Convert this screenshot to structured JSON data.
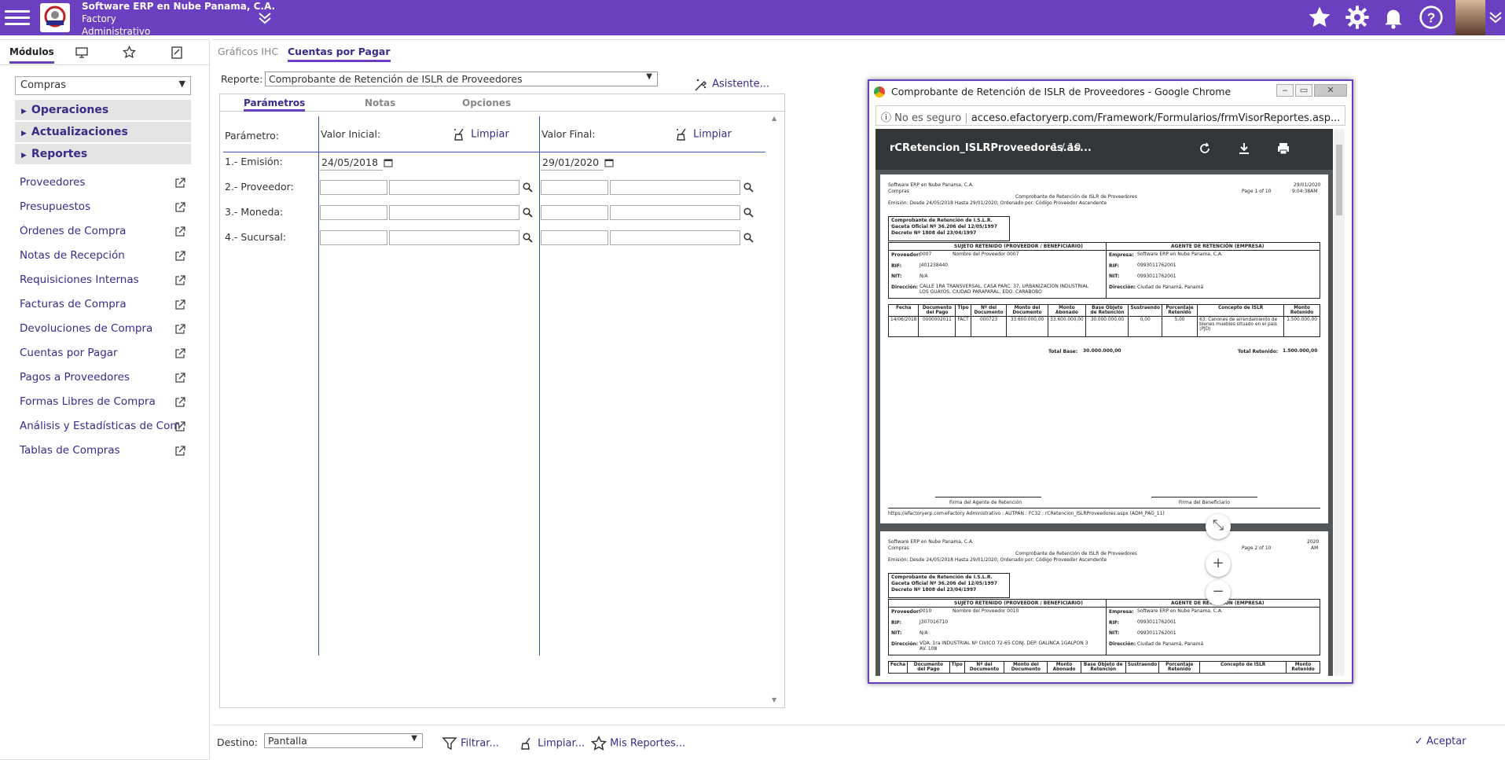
{
  "topbar": {
    "company_line1": "Software ERP en Nube Panama, C.A.",
    "company_line2": "Factory",
    "company_line3": "Administrativo",
    "icons": [
      "menu-icon",
      "star-icon",
      "gear-icon",
      "bell-icon",
      "help-icon",
      "user-avatar",
      "chevron-down-icon"
    ],
    "accent": "#6a3fc0"
  },
  "sidebar": {
    "tabs": [
      {
        "label": "Módulos"
      },
      {
        "icon": "monitor-icon"
      },
      {
        "icon": "star-icon"
      },
      {
        "icon": "report-icon"
      }
    ],
    "module_selected": "Compras",
    "sections": [
      {
        "label": "Operaciones"
      },
      {
        "label": "Actualizaciones"
      },
      {
        "label": "Reportes"
      }
    ],
    "items": [
      {
        "label": "Proveedores"
      },
      {
        "label": "Presupuestos"
      },
      {
        "label": "Órdenes de Compra"
      },
      {
        "label": "Notas de Recepción"
      },
      {
        "label": "Requisiciones Internas"
      },
      {
        "label": "Facturas de Compra"
      },
      {
        "label": "Devoluciones de Compra"
      },
      {
        "label": "Cuentas por Pagar"
      },
      {
        "label": "Pagos a Proveedores"
      },
      {
        "label": "Formas Libres de Compra"
      },
      {
        "label": "Análisis y Estadísticas de Com"
      },
      {
        "label": "Tablas de Compras"
      }
    ]
  },
  "main": {
    "tabs": [
      {
        "label": "Gráficos IHC"
      },
      {
        "label": "Cuentas por Pagar"
      }
    ],
    "reporte_label": "Reporte:",
    "reporte_value": "Comprobante de Retención de ISLR de Proveedores",
    "asistente": "Asistente...",
    "param_tabs": [
      {
        "label": "Parámetros"
      },
      {
        "label": "Notas"
      },
      {
        "label": "Opciones"
      }
    ],
    "param_header": "Parámetro:",
    "valor_inicial": "Valor Inicial:",
    "valor_final": "Valor Final:",
    "limpiar": "Limpiar",
    "params": [
      {
        "label": "1.- Emisión:",
        "ini": "24/05/2018",
        "fin": "29/01/2020"
      },
      {
        "label": "2.- Proveedor:"
      },
      {
        "label": "3.- Moneda:"
      },
      {
        "label": "4.- Sucursal:"
      }
    ]
  },
  "bottom": {
    "destino_label": "Destino:",
    "destino_value": "Pantalla",
    "filtrar": "Filtrar...",
    "limpiar": "Limpiar...",
    "mis_reportes": "Mis Reportes...",
    "aceptar": "Aceptar"
  },
  "browser": {
    "title": "Comprobante de Retención de ISLR de Proveedores - Google Chrome",
    "not_secure": "No es seguro",
    "url": "acceso.efactoryerp.com/Framework/Formularios/frmVisorReportes.asp...",
    "pdf_name": "rCRetencion_ISLRProveedores.as...",
    "pdf_page": "1 / 10",
    "page1": {
      "company": "Software ERP en Nube Panama, C.A.",
      "module": "Compras",
      "report_title": "Comprobante de Retención de ISLR de Proveedores",
      "filter": "Emisión: Desde 24/05/2018  Hasta 29/01/2020; Ordenado por: Código Proveedor Ascendente",
      "date": "29/01/2020",
      "time": "9:04:38AM",
      "page": "Page 1 of 10",
      "legal1": "Comprobante de Retención de I.S.L.R.",
      "legal2": "Gaceta Oficial Nº 36.206 del 12/05/1997",
      "legal3": "Decreto Nº 1808 del 23/04/1997",
      "suj_header": "SUJETO RETENIDO (PROVEEDOR / BENEFICIARIO)",
      "age_header": "AGENTE DE RETENCIÓN (EMPRESA)",
      "prov_label": "Proveedor:",
      "prov_code": "0007",
      "prov_name": "Nombre del Proveedor 0007",
      "rif_label": "RIF:",
      "rif": "J401238440",
      "nit_label": "NIT:",
      "nit": "N/A",
      "dir_label": "Dirección:",
      "dir": "CALLE 1RA TRANSVERSAL, CASA PARC. 37, URBANIZACION INDUSTRIAL LOS GUAYOS, CIUDAD PARAPARAL, EDO. CARABOBO",
      "emp_label": "Empresa:",
      "emp": "Software ERP en Nube Panama, C.A.",
      "emp_rif": "0993011762001",
      "emp_nit": "0993011762001",
      "emp_dir": "Ciudad de Panamá, Panamá",
      "cols": [
        "Fecha",
        "Documento del Pago",
        "Tipo",
        "Nº del Documento",
        "Monto del Documento",
        "Monto Abonado",
        "Base Objeto de Retención",
        "Sustraendo",
        "Porcentaje Retenido",
        "Concepto de ISLR",
        "Monto Retenido"
      ],
      "row": [
        "14/06/2018",
        "0000002011",
        "FACT",
        "000723",
        "33.600.000,00",
        "33.600.000,00",
        "30.000.000,00",
        "0,00",
        "5,00",
        "63. Canones de arrendamiento de bienes muebles situado en el pais (PJD)",
        "1.500.000,00"
      ],
      "total_base_label": "Total Base:",
      "total_base": "30.000.000,00",
      "total_ret_label": "Total Retenido:",
      "total_ret": "1.500.000,00",
      "firma1": "Firma del Agente de Retención",
      "firma2": "Firma del Beneficiario",
      "footer_url": "https://efactoryerp.com",
      "footer_info": "eFactory Administrativo  :  AUTPAN  :  FC32  :  rCRetencion_ISLRProveedores.aspx (ADM_PAG_11)"
    },
    "page2": {
      "company": "Software ERP en Nube Panama, C.A.",
      "module": "Compras",
      "report_title": "Comprobante de Retención de ISLR de Proveedores",
      "filter": "Emisión: Desde 24/05/2018  Hasta 29/01/2020; Ordenado por: Código Proveedor Ascendente",
      "date": "2020",
      "page": "Page 2 of 10",
      "time": "AM",
      "prov_code": "0010",
      "prov_name": "Nombre del Proveedor 0010",
      "rif": "J307016710",
      "nit": "N/A",
      "dir": "VDA. 1ra INDUSTRIAL Nº CIVICO 72-65 CONJ. DEP. GALINCA 1GALPON 3 AV. 108"
    }
  }
}
